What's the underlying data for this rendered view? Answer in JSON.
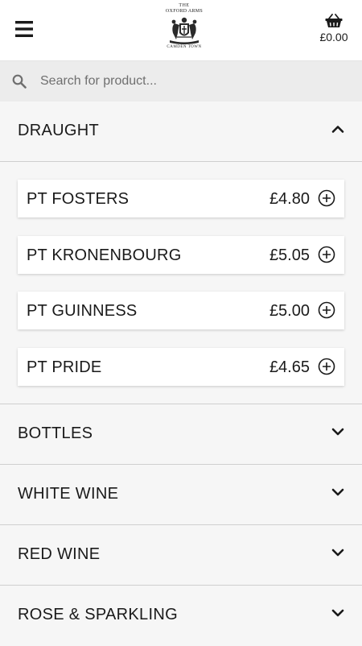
{
  "header": {
    "logo": {
      "line1": "THE",
      "line2": "OXFORD ARMS",
      "line3": "CAMDEN TOWN"
    },
    "basket_total": "£0.00",
    "icons": {
      "menu": "hamburger-menu-icon",
      "basket": "basket-icon"
    }
  },
  "search": {
    "placeholder": "Search for product...",
    "value": "",
    "icon": "search-icon"
  },
  "categories": [
    {
      "label": "DRAUGHT",
      "expanded": true,
      "products": [
        {
          "name": "PT FOSTERS",
          "price": "£4.80"
        },
        {
          "name": "PT KRONENBOURG",
          "price": "£5.05"
        },
        {
          "name": "PT GUINNESS",
          "price": "£5.00"
        },
        {
          "name": "PT PRIDE",
          "price": "£4.65"
        }
      ]
    },
    {
      "label": "BOTTLES",
      "expanded": false
    },
    {
      "label": "WHITE WINE",
      "expanded": false
    },
    {
      "label": "RED WINE",
      "expanded": false
    },
    {
      "label": "ROSE & SPARKLING",
      "expanded": false
    }
  ],
  "colors": {
    "background": "#f6f6f6",
    "header_bg": "#ffffff",
    "search_bg": "#ececec",
    "card_bg": "#ffffff",
    "text": "#1a1a1a"
  }
}
